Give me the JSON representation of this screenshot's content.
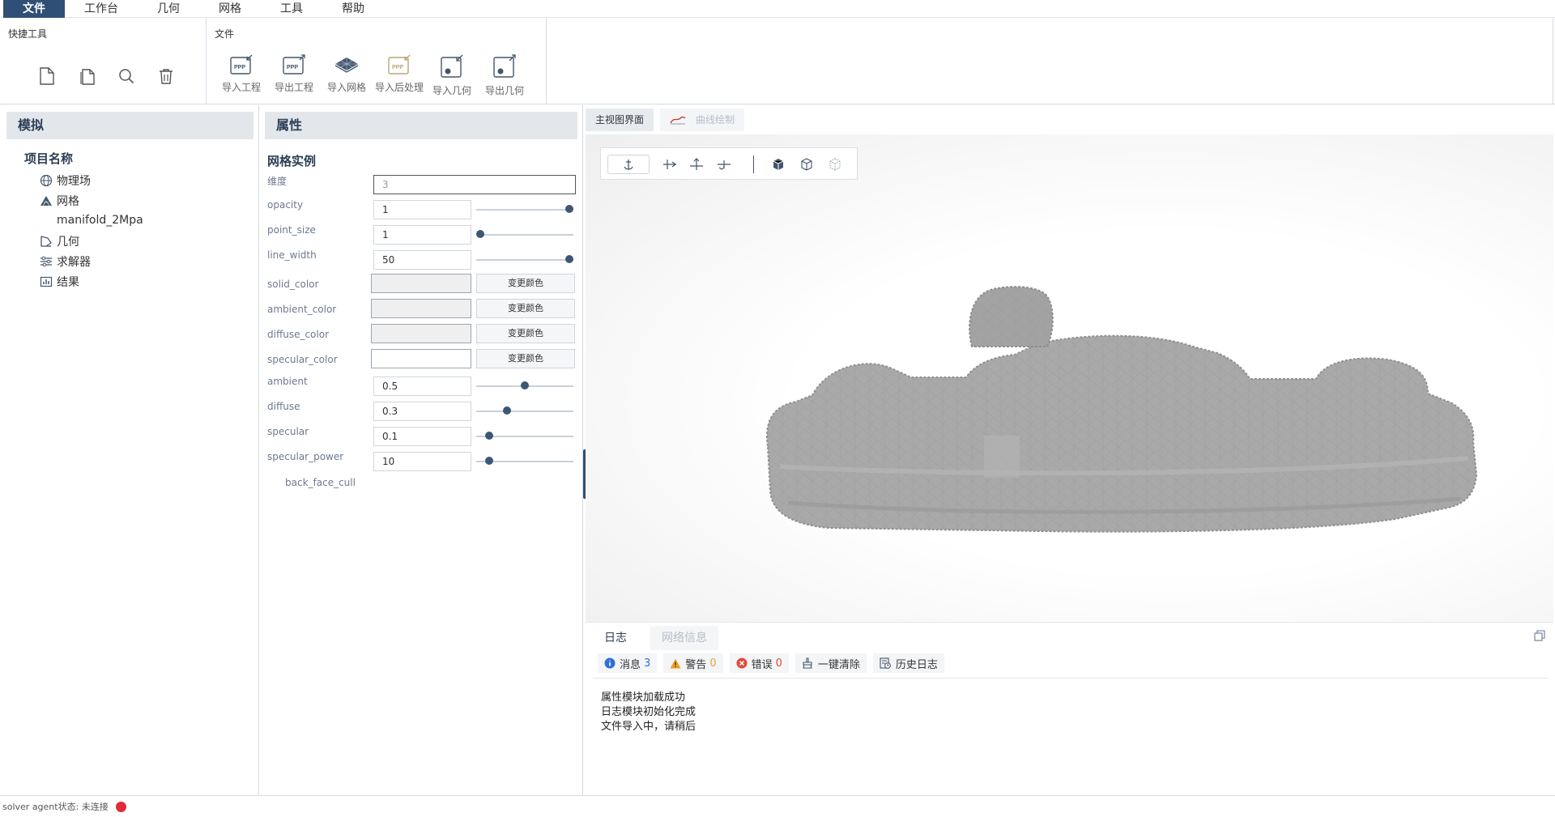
{
  "menu": [
    "文件",
    "工作台",
    "几何",
    "网格",
    "工具",
    "帮助"
  ],
  "ribbon": {
    "quick_title": "快捷工具",
    "quick_icons": [
      "new-file-icon",
      "copy-file-icon",
      "search-icon",
      "trash-icon"
    ],
    "file_title": "文件",
    "file_tools": [
      {
        "label": "导入工程",
        "icon": "import-project-icon"
      },
      {
        "label": "导出工程",
        "icon": "export-project-icon"
      },
      {
        "label": "导入网格",
        "icon": "import-mesh-icon"
      },
      {
        "label": "导入后处理",
        "icon": "import-postprocess-icon"
      },
      {
        "label": "导入几何",
        "icon": "import-geometry-icon"
      },
      {
        "label": "导出几何",
        "icon": "export-geometry-icon"
      }
    ]
  },
  "sim": {
    "header": "模拟",
    "root": "项目名称",
    "items": [
      {
        "label": "物理场",
        "icon": "globe-icon"
      },
      {
        "label": "网格",
        "icon": "mesh-icon"
      },
      {
        "label": "几何",
        "icon": "geometry-icon"
      },
      {
        "label": "求解器",
        "icon": "solver-icon"
      },
      {
        "label": "结果",
        "icon": "chart-icon"
      }
    ],
    "mesh_child": "manifold_2Mpa"
  },
  "props": {
    "header": "属性",
    "title": "网格实例",
    "dimension": {
      "label": "维度",
      "value": "3"
    },
    "sliders": [
      {
        "label": "opacity",
        "value": "1",
        "level": 1.0
      },
      {
        "label": "point_size",
        "value": "1",
        "level": 0.0
      },
      {
        "label": "line_width",
        "value": "50",
        "level": 1.0
      }
    ],
    "colors": [
      {
        "label": "solid_color",
        "button": "变更颜色",
        "swatch": "#efefef"
      },
      {
        "label": "ambient_color",
        "button": "变更颜色",
        "swatch": "#efefef"
      },
      {
        "label": "diffuse_color",
        "button": "变更颜色",
        "swatch": "#efefef"
      },
      {
        "label": "specular_color",
        "button": "变更颜色",
        "swatch": "#ffffff"
      }
    ],
    "sliders2": [
      {
        "label": "ambient",
        "value": "0.5",
        "level": 0.5
      },
      {
        "label": "diffuse",
        "value": "0.3",
        "level": 0.3
      },
      {
        "label": "specular",
        "value": "0.1",
        "level": 0.1
      },
      {
        "label": "specular_power",
        "value": "10",
        "level": 0.1
      }
    ],
    "back_face_cull": "back_face_cull"
  },
  "view": {
    "tab_main": "主视图界面",
    "tab_curve": "曲线绘制",
    "model_color": "#a9a9a9"
  },
  "log": {
    "tab_log": "日志",
    "tab_net": "网络信息",
    "info_label": "消息",
    "info_count": "3",
    "warn_label": "警告",
    "warn_count": "0",
    "error_label": "错误",
    "error_count": "0",
    "clear_label": "一键清除",
    "history_label": "历史日志",
    "lines": [
      "属性模块加载成功",
      "日志模块初始化完成",
      "文件导入中，请稍后"
    ]
  },
  "status": {
    "text": "solver agent状态:  未连接",
    "dot_color": "#e02b36"
  }
}
